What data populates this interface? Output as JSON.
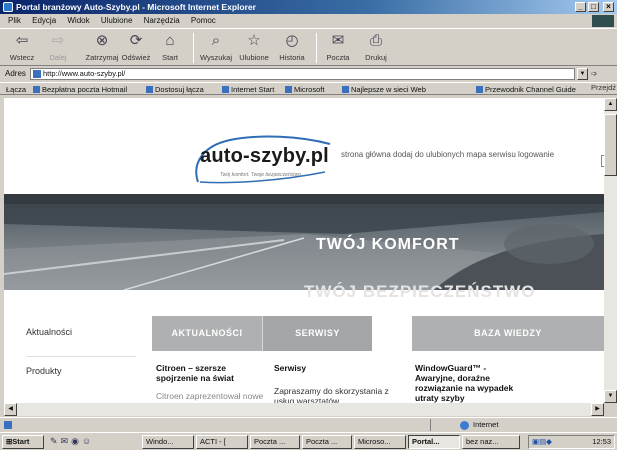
{
  "window": {
    "title": "Portal branżowy Auto-Szyby.pl - Microsoft Internet Explorer",
    "controls": [
      "_",
      "□",
      "×"
    ]
  },
  "menu": [
    "Plik",
    "Edycja",
    "Widok",
    "Ulubione",
    "Narzędzia",
    "Pomoc"
  ],
  "toolbar": [
    {
      "label": "Wstecz",
      "icon": "back-icon",
      "glyph": "⇦",
      "disabled": false
    },
    {
      "label": "Dalej",
      "icon": "forward-icon",
      "glyph": "⇨",
      "disabled": true
    },
    {
      "label": "Zatrzymaj",
      "icon": "stop-icon",
      "glyph": "⊗",
      "disabled": false
    },
    {
      "label": "Odśwież",
      "icon": "refresh-icon",
      "glyph": "⟳",
      "disabled": false
    },
    {
      "label": "Start",
      "icon": "home-icon",
      "glyph": "⌂",
      "disabled": false
    },
    {
      "label": "Wyszukaj",
      "icon": "search-icon",
      "glyph": "⌕",
      "disabled": false
    },
    {
      "label": "Ulubione",
      "icon": "favorites-icon",
      "glyph": "☆",
      "disabled": false
    },
    {
      "label": "Historia",
      "icon": "history-icon",
      "glyph": "◴",
      "disabled": false
    },
    {
      "label": "Poczta",
      "icon": "mail-icon",
      "glyph": "✉",
      "disabled": false
    },
    {
      "label": "Drukuj",
      "icon": "print-icon",
      "glyph": "⎙",
      "disabled": false
    }
  ],
  "address": {
    "label": "Adres",
    "url": "http://www.auto-szyby.pl/",
    "go_label": "Przejdź"
  },
  "links": {
    "label": "Łącza",
    "items": [
      "Bezpłatna poczta Hotmail",
      "Dostosuj łącza",
      "Internet Start",
      "Microsoft",
      "Najlepsze w sieci Web",
      "Przewodnik Channel Guide"
    ]
  },
  "site": {
    "logo": "auto-szyby.pl",
    "tagline": "Twój komfort. Twoje bezpieczeństwo.",
    "top_links": "strona główna dodaj do ulubionych mapa serwisu logowanie",
    "banner_text": "TWÓJ KOMFORT",
    "banner_blur_text": "TWÓJ BEZPIECZEŃSTWO",
    "tabs": [
      "AKTUALNOŚCI",
      "SERWISY",
      "BAZA WIEDZY"
    ],
    "left_nav": [
      "Aktualności",
      "Produkty"
    ],
    "col1": {
      "title": "Citroen – szersze spojrzenie na świat",
      "sub": "Citroen zaprezentował nowe"
    },
    "col2": {
      "title": "Serwisy",
      "text": "Zapraszamy do skorzystania z usług warsztatów"
    },
    "col3": {
      "title": "WindowGuard™ - Awaryjne, doraźne rozwiązanie na wypadek utraty szyby"
    }
  },
  "status": {
    "icon": "ie-page-icon",
    "zone": "Internet"
  },
  "taskbar": {
    "start": "Start",
    "tasks": [
      "Windo...",
      "ACTI - [",
      "Poczta ...",
      "Poczta ...",
      "Microso...",
      "Portal...",
      "bez naz..."
    ],
    "active_task": "Portal...",
    "clock": "12:53"
  },
  "colors": {
    "title_bar": "#0a246a",
    "tab_gray": "#aeb0b2",
    "tab_dark": "#9a9c9e",
    "logo_swoosh": "#2f6db5"
  }
}
